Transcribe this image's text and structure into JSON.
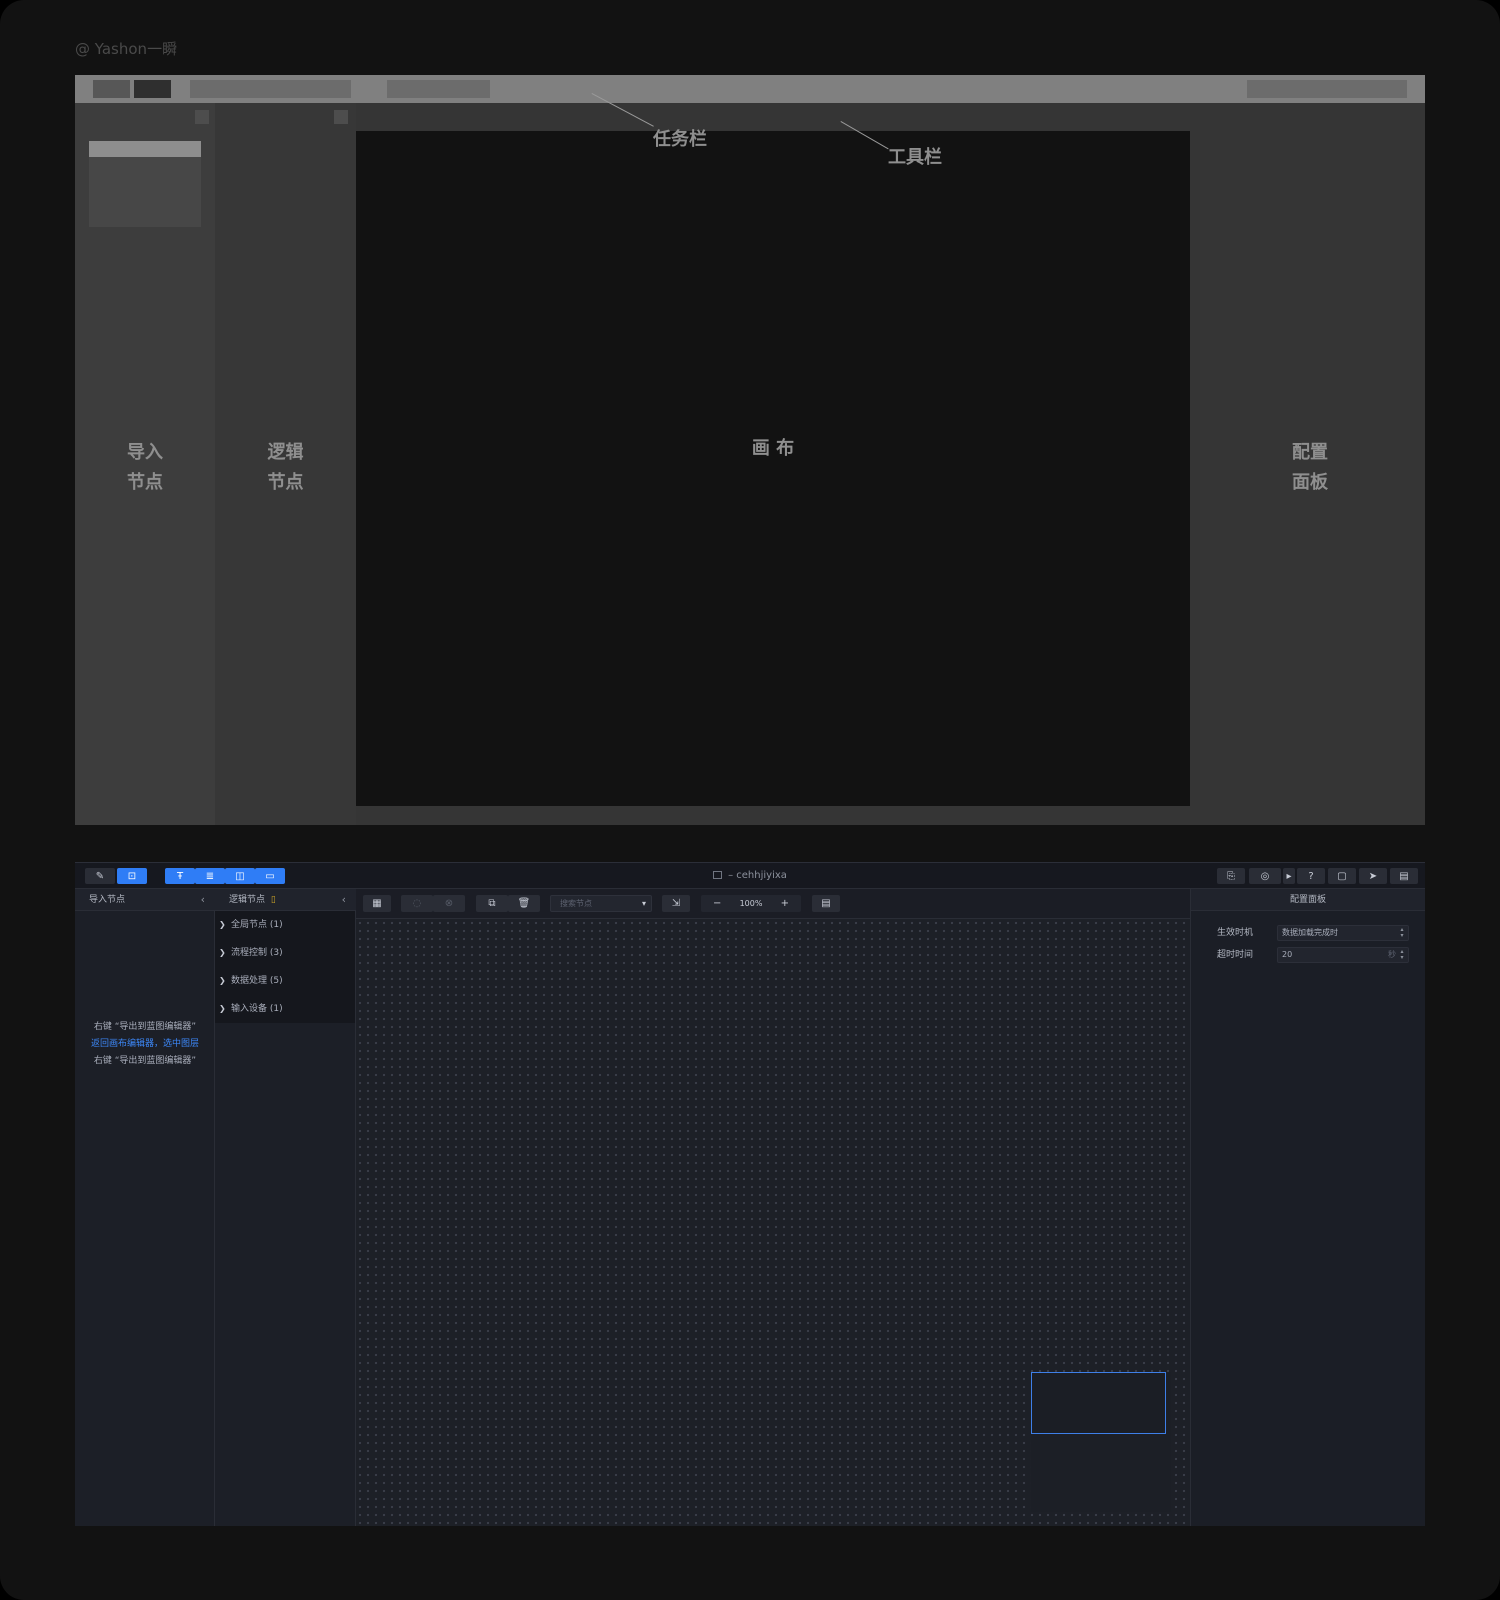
{
  "watermark": "@ Yashon一瞬",
  "wireframe": {
    "callouts": {
      "taskbar": "任务栏",
      "toolbar": "工具栏"
    },
    "labels": {
      "import_nodes": [
        "导入",
        "节点"
      ],
      "logic_nodes": [
        "逻辑",
        "节点"
      ],
      "canvas": "画 布",
      "config_panel": [
        "配置",
        "面板"
      ]
    }
  },
  "app": {
    "title_suffix": "– cehhjiyixa",
    "titlebar_left_icons": [
      "edit-icon",
      "cart-icon",
      "text-icon",
      "layers-icon",
      "split-icon",
      "window-icon"
    ],
    "titlebar_right_icons": [
      "clipboard-icon",
      "camera-icon",
      "caret-icon",
      "help-icon",
      "monitor-icon",
      "send-icon",
      "message-icon"
    ],
    "import_panel": {
      "title": "导入节点",
      "hints": [
        "右键 “导出到蓝图编辑器”",
        "返回画布编辑器，选中图层",
        "右键 “导出到蓝图编辑器”"
      ]
    },
    "logic_panel": {
      "title": "逻辑节点",
      "tree": [
        "全局节点 (1)",
        "流程控制 (3)",
        "数据处理 (5)",
        "输入设备 (1)"
      ]
    },
    "toolbar": {
      "search_placeholder": "搜索节点",
      "zoom": "100%",
      "zoom_minus": "−",
      "zoom_plus": "+"
    },
    "config_panel": {
      "title": "配置面板",
      "fields": [
        {
          "label": "生效时机",
          "value": "数据加载完成时"
        },
        {
          "label": "超时时间",
          "value": "20",
          "unit": "秒"
        }
      ]
    },
    "colors": {
      "accent": "#2f7df6",
      "canvas": "#1d2027",
      "panel": "#1c1f27"
    }
  }
}
